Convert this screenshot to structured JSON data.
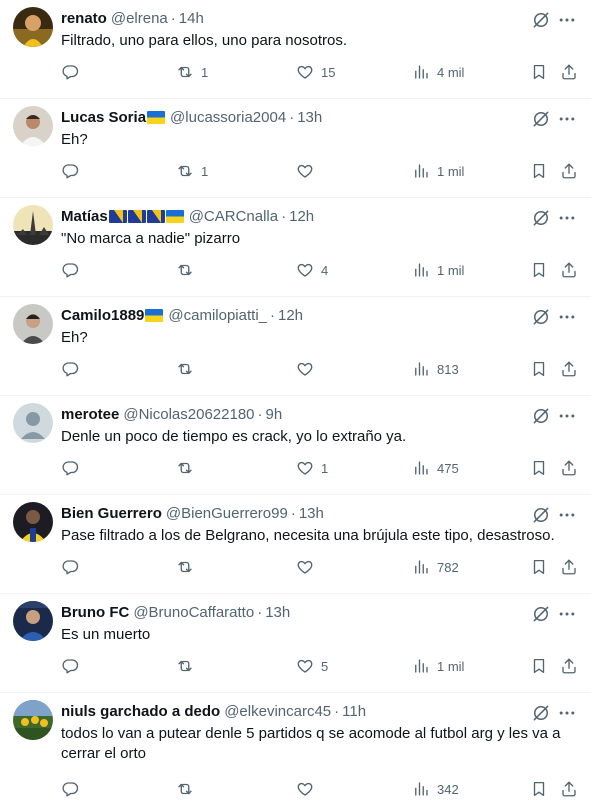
{
  "replies": [
    {
      "name": "renato",
      "flags": [],
      "handle": "@elrena",
      "time": "14h",
      "text": "Filtrado, uno para ellos, uno para nosotros.",
      "replies_count": "",
      "reposts": "1",
      "likes": "15",
      "views": "4 mil",
      "avatar": "avatar-renato"
    },
    {
      "name": "Lucas Soria",
      "flags": [
        "ua"
      ],
      "handle": "@lucassoria2004",
      "time": "13h",
      "text": "Eh?",
      "replies_count": "",
      "reposts": "1",
      "likes": "",
      "views": "1 mil",
      "avatar": "avatar-lucas"
    },
    {
      "name": "Matías",
      "flags": [
        "ba",
        "ba",
        "ba",
        "ua"
      ],
      "handle": "@CARCnalla",
      "time": "12h",
      "text": "\"No marca a nadie\" pizarro",
      "replies_count": "",
      "reposts": "",
      "likes": "4",
      "views": "1 mil",
      "avatar": "avatar-matias"
    },
    {
      "name": "Camilo1889",
      "flags": [
        "ua"
      ],
      "handle": "@camilopiatti_",
      "time": "12h",
      "text": "Eh?",
      "replies_count": "",
      "reposts": "",
      "likes": "",
      "views": "813",
      "avatar": "avatar-camilo"
    },
    {
      "name": "merotee",
      "flags": [],
      "handle": "@Nicolas20622180",
      "time": "9h",
      "text": "Denle un poco de tiempo es crack, yo lo extraño ya.",
      "replies_count": "",
      "reposts": "",
      "likes": "1",
      "views": "475",
      "avatar": "avatar-default"
    },
    {
      "name": "Bien Guerrero",
      "flags": [],
      "handle": "@BienGuerrero99",
      "time": "13h",
      "text": "Pase filtrado a los de Belgrano, necesita una brújula este tipo, desastroso.",
      "replies_count": "",
      "reposts": "",
      "likes": "",
      "views": "782",
      "avatar": "avatar-bien"
    },
    {
      "name": "Bruno FC",
      "flags": [],
      "handle": "@BrunoCaffaratto",
      "time": "13h",
      "text": "Es un muerto",
      "replies_count": "",
      "reposts": "",
      "likes": "5",
      "views": "1 mil",
      "avatar": "avatar-bruno"
    },
    {
      "name": "niuls garchado a dedo",
      "flags": [],
      "handle": "@elkevincarc45",
      "time": "11h",
      "text": "todos lo van a putear denle 5 partidos q se acomode al futbol arg y les va a cerrar el orto",
      "replies_count": "",
      "reposts": "",
      "likes": "",
      "views": "342",
      "avatar": "avatar-niuls"
    }
  ],
  "colors": {
    "text": "#0f1419",
    "secondary": "#536471",
    "divider": "#eff3f4",
    "ukraine_blue": "#1a6fd4",
    "ukraine_yellow": "#f7d31a",
    "bosnia_blue": "#1f3c96"
  }
}
